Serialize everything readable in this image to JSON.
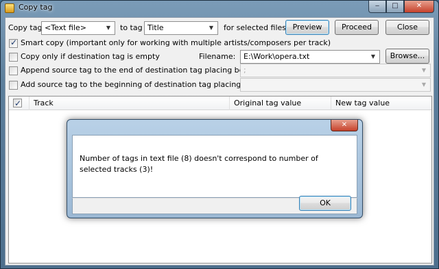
{
  "window": {
    "title": "Copy tag",
    "minimize_glyph": "‒",
    "maximize_glyph": "□",
    "close_glyph": "✕"
  },
  "row1": {
    "copy_tag_label": "Copy tag",
    "source_tag_value": "<Text file>",
    "to_tag_label": "to tag",
    "dest_tag_value": "Title",
    "for_selected_label": "for selected files",
    "preview_label": "Preview",
    "proceed_label": "Proceed",
    "close_label": "Close"
  },
  "options": {
    "smart_copy_label": "Smart copy (important only for working with multiple artists/composers per track)",
    "smart_copy_checked": true,
    "copy_if_empty_label": "Copy only if destination tag is empty",
    "copy_if_empty_checked": false,
    "filename_label": "Filename:",
    "filename_value": "E:\\Work\\opera.txt",
    "browse_label": "Browse...",
    "append_label": "Append source tag to the end of destination tag placing between them:",
    "append_checked": false,
    "append_value": ";",
    "prepend_label": "Add source tag to the beginning of destination tag placing between them:",
    "prepend_checked": false,
    "prepend_value": ""
  },
  "grid": {
    "header_checked": true,
    "columns": [
      "Track",
      "Original tag value",
      "New tag value"
    ],
    "rows": []
  },
  "dialog": {
    "message": "Number of tags in text file (8) doesn't correspond to number of selected tracks (3)!",
    "ok_label": "OK",
    "close_glyph": "✕"
  },
  "icons": {
    "app": "copy-tag-icon",
    "dropdown": "chevron-down-icon",
    "checkmark": "checkmark-icon"
  }
}
